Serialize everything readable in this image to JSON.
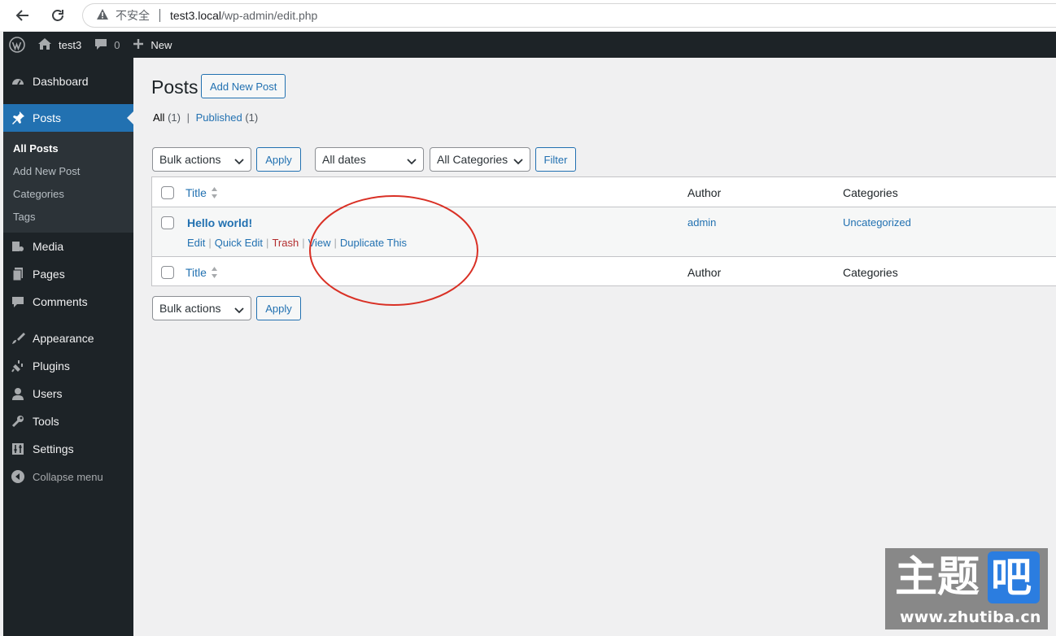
{
  "browser": {
    "insecure_label": "不安全",
    "url_host": "test3.local",
    "url_path": "/wp-admin/edit.php"
  },
  "adminbar": {
    "site_name": "test3",
    "comments_count": "0",
    "new_label": "New"
  },
  "sidebar": {
    "items": [
      {
        "label": "Dashboard",
        "icon": "dashboard-icon"
      },
      {
        "label": "Posts",
        "icon": "pushpin-icon",
        "current": true
      },
      {
        "label": "Media",
        "icon": "media-icon"
      },
      {
        "label": "Pages",
        "icon": "pages-icon"
      },
      {
        "label": "Comments",
        "icon": "comment-icon"
      },
      {
        "label": "Appearance",
        "icon": "paintbrush-icon"
      },
      {
        "label": "Plugins",
        "icon": "plugin-icon"
      },
      {
        "label": "Users",
        "icon": "user-icon"
      },
      {
        "label": "Tools",
        "icon": "wrench-icon"
      },
      {
        "label": "Settings",
        "icon": "settings-icon"
      }
    ],
    "posts_submenu": [
      "All Posts",
      "Add New Post",
      "Categories",
      "Tags"
    ],
    "collapse_label": "Collapse menu"
  },
  "main": {
    "page_title": "Posts",
    "add_new_label": "Add New Post",
    "views": {
      "all_label": "All",
      "all_count": "(1)",
      "separator": "|",
      "published_label": "Published",
      "published_count": "(1)"
    },
    "bulk_actions": "Bulk actions",
    "apply_label": "Apply",
    "dates_filter": "All dates",
    "categories_filter": "All Categories",
    "filter_label": "Filter",
    "table": {
      "columns": [
        "Title",
        "Author",
        "Categories"
      ],
      "rows": [
        {
          "title": "Hello world!",
          "author": "admin",
          "categories": "Uncategorized",
          "actions": [
            "Edit",
            "Quick Edit",
            "Trash",
            "View",
            "Duplicate This"
          ]
        }
      ]
    }
  },
  "annotation": {
    "color": "#d93025",
    "shape": "ellipse"
  },
  "watermark": {
    "zh_main": "主题",
    "zh_box": "吧",
    "url": "www.zhutiba.cn"
  },
  "colors": {
    "wp_blue": "#2271b1",
    "adminbar": "#1d2327",
    "trash_red": "#b32d2e"
  }
}
